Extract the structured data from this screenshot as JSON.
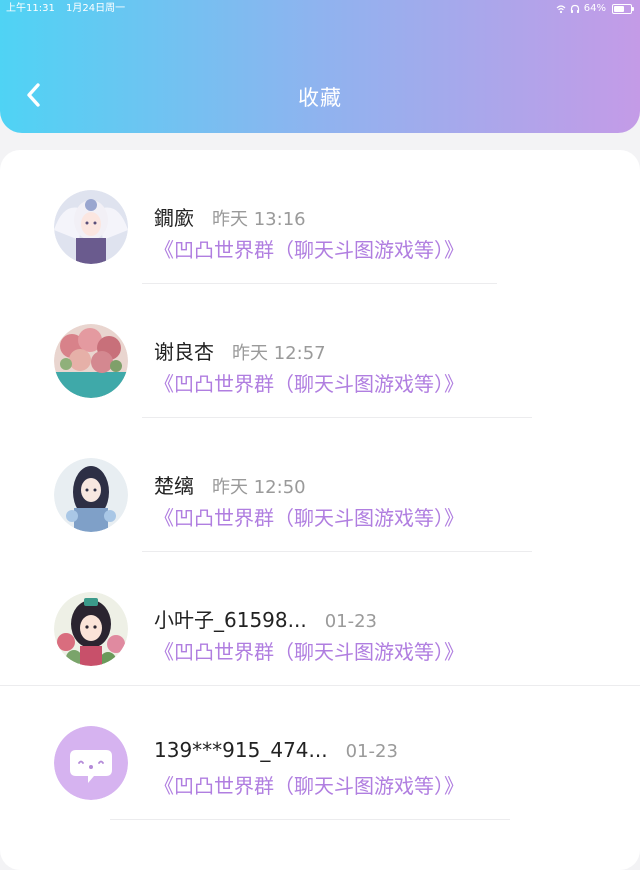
{
  "status_bar": {
    "time": "上午11:31",
    "date": "1月24日周一",
    "battery": "64%",
    "battery_level": 0.64
  },
  "header": {
    "title": "收藏",
    "back_icon": "chevron-left-icon"
  },
  "colors": {
    "accent": "#b07ee0",
    "header_gradient_start": "#4fd3f4",
    "header_gradient_end": "#c49be7"
  },
  "favorites": [
    {
      "name": "鐗廞",
      "time": "昨天 13:16",
      "group": "《凹凸世界群（聊天斗图游戏等）》",
      "avatar": "anime-girl-white-hair-avatar"
    },
    {
      "name": "谢良杏",
      "time": "昨天 12:57",
      "group": "《凹凸世界群（聊天斗图游戏等）》",
      "avatar": "flower-bouquet-avatar"
    },
    {
      "name": "楚缡",
      "time": "昨天 12:50",
      "group": "《凹凸世界群（聊天斗图游戏等）》",
      "avatar": "anime-girl-dark-hair-avatar"
    },
    {
      "name": "小叶子_61598...",
      "time": "01-23",
      "group": "《凹凸世界群（聊天斗图游戏等）》",
      "avatar": "anime-girl-flowers-avatar"
    },
    {
      "name": "139***915_474...",
      "time": "01-23",
      "group": "《凹凸世界群（聊天斗图游戏等）》",
      "avatar": "default-chat-bubble-avatar"
    }
  ]
}
